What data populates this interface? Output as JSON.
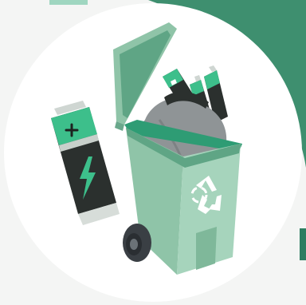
{
  "illustration": {
    "subject": "battery-recycling-bin",
    "colors": {
      "background": "#f4f5f4",
      "corner_green": "#3e8f6f",
      "circle": "#ffffff",
      "bin_body": "#8fc4a8",
      "bin_dark": "#5fa585",
      "bin_rim": "#2e9c74",
      "bag": "#8f9496",
      "battery_body": "#2b302e",
      "battery_top": "#3dbf8b",
      "recycle_symbol": "#ffffff",
      "wheel": "#3a3f44"
    },
    "icons": [
      "plus-icon",
      "lightning-icon",
      "recycle-icon",
      "wheel-icon"
    ]
  }
}
